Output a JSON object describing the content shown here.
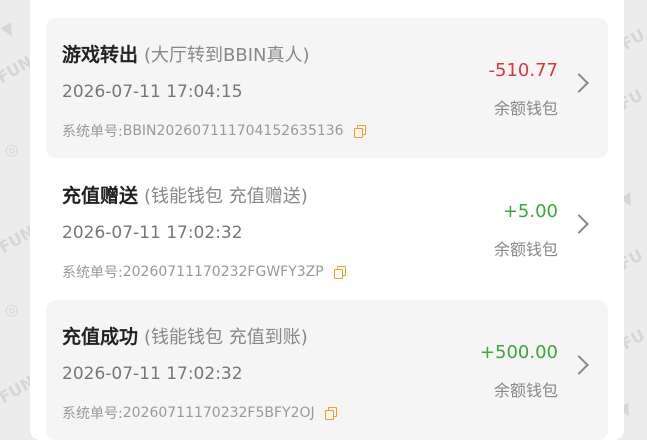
{
  "transactions": [
    {
      "title": "游戏转出",
      "subtitle": "(大厅转到BBIN真人)",
      "time": "2026-07-11 17:04:15",
      "order_prefix": "系统单号: ",
      "order_no": "BBIN20260711170415263513​6",
      "amount": "-510.77",
      "amount_type": "negative",
      "wallet": "余额钱包"
    },
    {
      "title": "充值赠送",
      "subtitle": "(钱能钱包 充值赠送)",
      "time": "2026-07-11 17:02:32",
      "order_prefix": "系统单号: ",
      "order_no": "20260711170232FGWFY3ZP",
      "amount": "+5.00",
      "amount_type": "positive",
      "wallet": "余额钱包"
    },
    {
      "title": "充值成功",
      "subtitle": "(钱能钱包 充值到账)",
      "time": "2026-07-11 17:02:32",
      "order_prefix": "系统单号: ",
      "order_no": "20260711170232F5BFY2OJ",
      "amount": "+500.00",
      "amount_type": "positive",
      "wallet": "余额钱包"
    }
  ],
  "colors": {
    "negative": "#e0343a",
    "positive": "#3aa83a",
    "copy_icon": "#f0a020"
  }
}
